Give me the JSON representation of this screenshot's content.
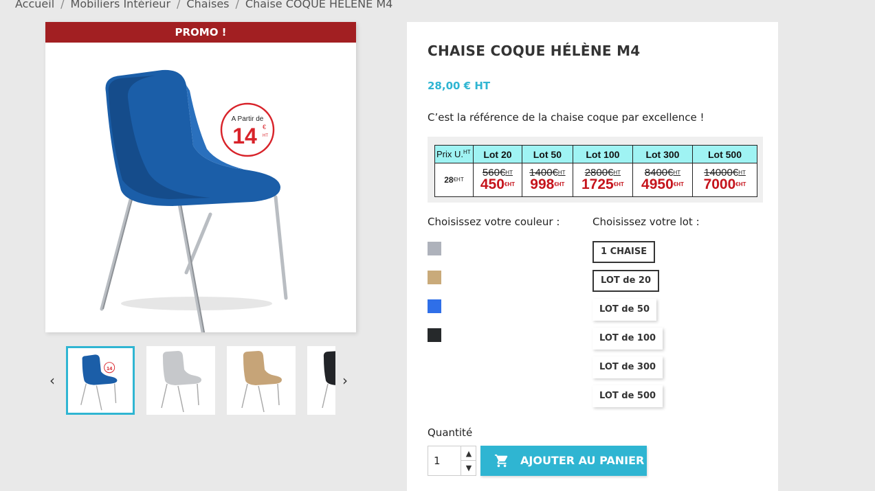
{
  "breadcrumb": [
    "Accueil",
    "Mobiliers Intérieur",
    "Chaises",
    "Chaise COQUE HÉLÈNE M4"
  ],
  "gallery": {
    "promo": "PROMO !",
    "badge": {
      "line1": "A Partir de",
      "price": "14",
      "unit1": "€",
      "unit2": "HT"
    },
    "thumbs": [
      "chaise-bleue",
      "chaise-grise",
      "chaise-beige",
      "chaise-noire"
    ]
  },
  "product": {
    "title": "CHAISE COQUE HÉLÈNE M4",
    "price": "28,00 € HT",
    "description": "C’est la référence de la chaise coque par excellence !"
  },
  "lot_table": {
    "header_first": "Prix U.",
    "header_first_sup": "HT",
    "headers": [
      "Lot 20",
      "Lot 50",
      "Lot 100",
      "Lot 300",
      "Lot 500"
    ],
    "unit_price": "28",
    "unit_price_sup": "€HT",
    "old_prices": [
      "560€",
      "1400€",
      "2800€",
      "8400€",
      "14000€"
    ],
    "new_prices": [
      "450",
      "998",
      "1725",
      "4950",
      "7000"
    ],
    "old_sup": "HT",
    "new_sup": "€HT"
  },
  "color_label": "Choisissez votre couleur :",
  "colors": [
    "#aeb2bb",
    "#c9aa7a",
    "#2f6fe8",
    "#26292b"
  ],
  "lot_label": "Choisissez votre lot :",
  "lots": [
    "1 CHAISE",
    "LOT de 20",
    "LOT de 50",
    "LOT de 100",
    "LOT de 300",
    "LOT de 500"
  ],
  "quantity_label": "Quantité",
  "quantity_value": "1",
  "cart_button": "AJOUTER AU PANIER"
}
